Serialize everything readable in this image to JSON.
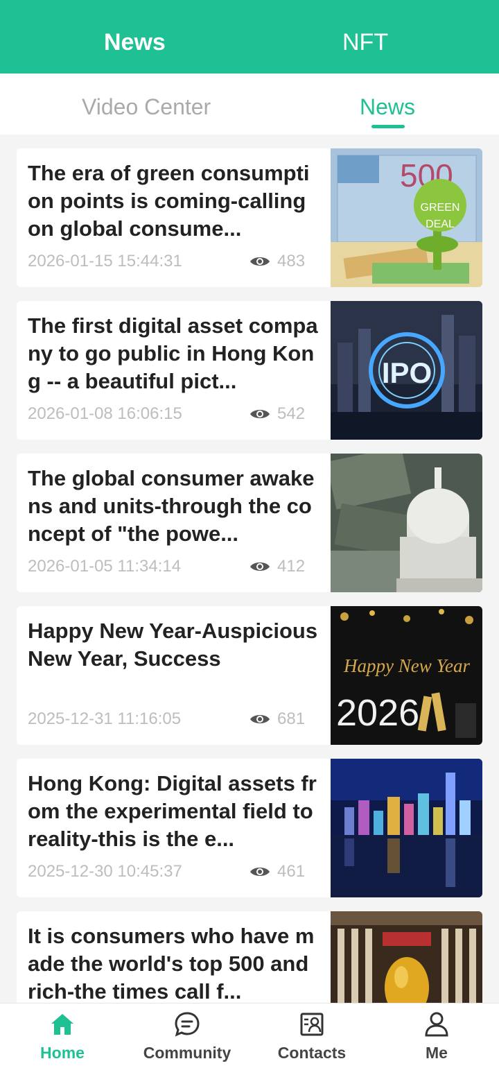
{
  "top_tabs": {
    "news": "News",
    "nft": "NFT"
  },
  "sub_tabs": {
    "video_center": "Video Center",
    "news": "News"
  },
  "colors": {
    "accent": "#1fc093",
    "muted": "#bdbdbd",
    "title": "#222222"
  },
  "articles": [
    {
      "title": "The era of green consumption points is coming-calling on global consume...",
      "date": "2026-01-15 15:44:31",
      "views": "483",
      "image": "green-deal-euro-image",
      "image_text": [
        "500",
        "GREEN",
        "DEAL"
      ]
    },
    {
      "title": "The first digital asset company to go public in Hong Kong -- a beautiful pict...",
      "date": "2026-01-08 16:06:15",
      "views": "542",
      "image": "ipo-hong-kong-night-image",
      "image_text": [
        "IPO"
      ]
    },
    {
      "title": "The global consumer awakens and units-through the concept of \"the powe...",
      "date": "2026-01-05 11:34:14",
      "views": "412",
      "image": "capitol-dollar-image",
      "image_text": []
    },
    {
      "title": "Happy New Year-Auspicious New Year, Success",
      "date": "2025-12-31 11:16:05",
      "views": "681",
      "image": "happy-new-year-2026-image",
      "image_text": [
        "Happy New Year",
        "2026"
      ]
    },
    {
      "title": "Hong Kong: Digital assets from the experimental field to reality-this is the e...",
      "date": "2025-12-30 10:45:37",
      "views": "461",
      "image": "hong-kong-skyline-image",
      "image_text": []
    },
    {
      "title": "It is consumers who have made the world's top 500 and rich-the times call f...",
      "date": "",
      "views": "",
      "image": "golden-egg-image",
      "image_text": []
    }
  ],
  "bottom_nav": [
    {
      "label": "Home",
      "icon": "home-icon",
      "active": true
    },
    {
      "label": "Community",
      "icon": "chat-icon",
      "active": false
    },
    {
      "label": "Contacts",
      "icon": "contacts-icon",
      "active": false
    },
    {
      "label": "Me",
      "icon": "person-icon",
      "active": false
    }
  ]
}
